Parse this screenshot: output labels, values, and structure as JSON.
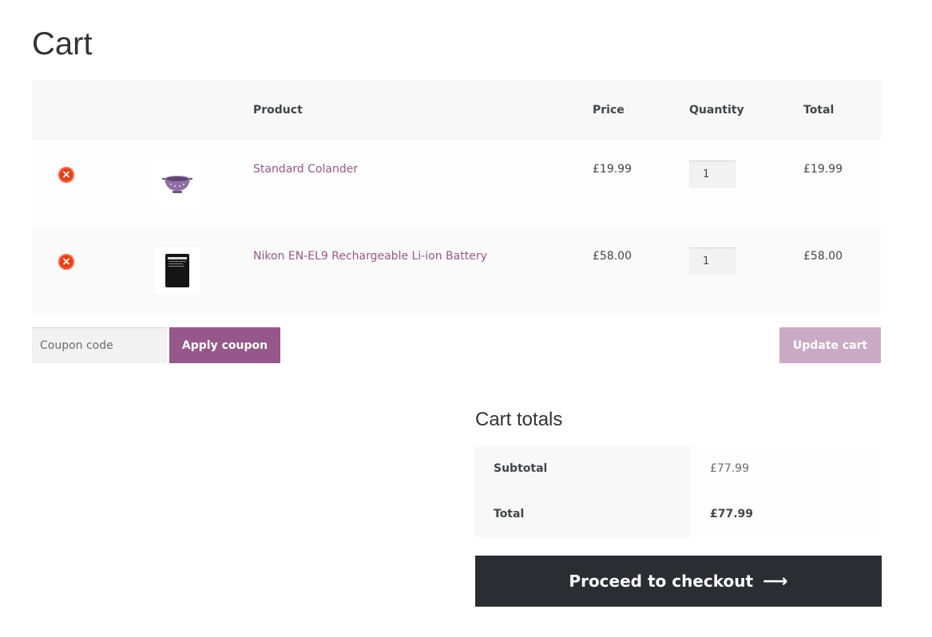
{
  "page": {
    "title": "Cart"
  },
  "table": {
    "headers": {
      "product": "Product",
      "price": "Price",
      "quantity": "Quantity",
      "total": "Total"
    },
    "rows": [
      {
        "name": "Standard Colander",
        "price": "£19.99",
        "qty": "1",
        "total": "£19.99",
        "remove_icon": "remove-icon"
      },
      {
        "name": "Nikon EN-EL9 Rechargeable Li-ion Battery",
        "price": "£58.00",
        "qty": "1",
        "total": "£58.00",
        "remove_icon": "remove-icon"
      }
    ]
  },
  "actions": {
    "coupon_placeholder": "Coupon code",
    "apply_coupon": "Apply coupon",
    "update_cart": "Update cart"
  },
  "totals": {
    "title": "Cart totals",
    "subtotal_label": "Subtotal",
    "subtotal_value": "£77.99",
    "total_label": "Total",
    "total_value": "£77.99"
  },
  "checkout": {
    "label": "Proceed to checkout",
    "icon": "arrow-right-icon"
  },
  "colors": {
    "brand": "#96588a",
    "brand_muted": "#cbaac5",
    "remove": "#e2401c",
    "dark": "#2c2d33"
  }
}
